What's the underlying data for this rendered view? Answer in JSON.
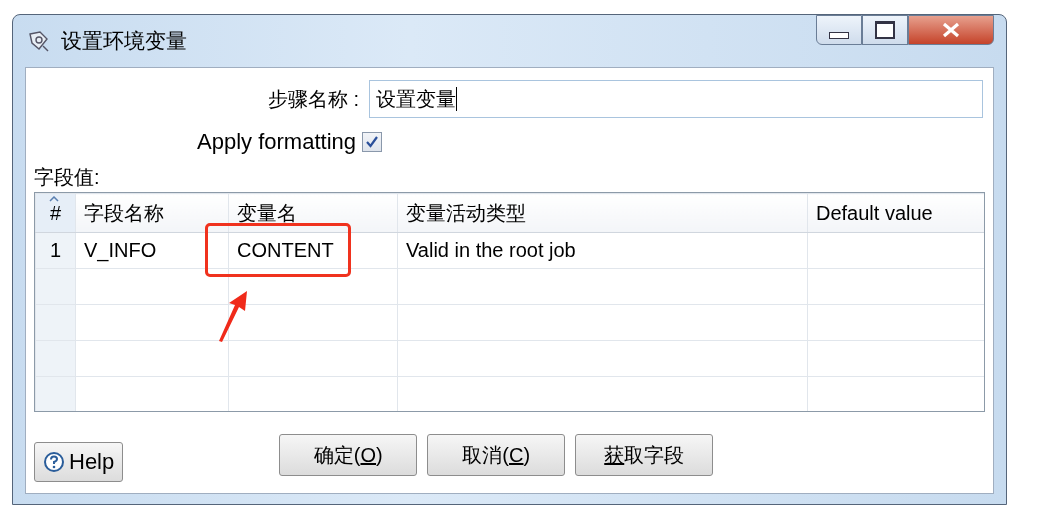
{
  "window": {
    "title": "设置环境变量"
  },
  "step_name": {
    "label": "步骤名称 :",
    "value": "设置变量"
  },
  "apply_formatting": {
    "label": "Apply formatting",
    "checked": true
  },
  "fields_label": "字段值:",
  "table": {
    "columns": [
      "#",
      "字段名称",
      "变量名",
      "变量活动类型",
      "Default value"
    ],
    "rows": [
      [
        "1",
        "V_INFO",
        "CONTENT",
        "Valid in the root job"
      ]
    ]
  },
  "annotations": {
    "highlight_box": true,
    "arrow": true
  },
  "help_button": {
    "label": "Help"
  },
  "buttons": [
    {
      "before": "确定(",
      "key": "O",
      "after": ")"
    },
    {
      "before": "取消(",
      "key": "C",
      "after": ")"
    },
    {
      "key": "获",
      "after": "取字段"
    }
  ]
}
